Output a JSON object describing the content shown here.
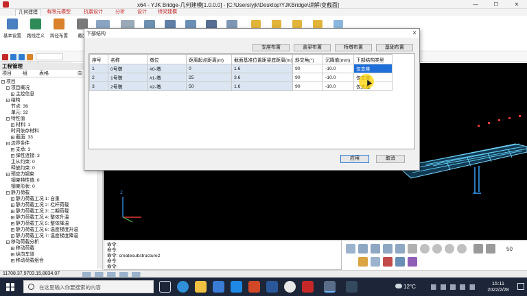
{
  "window": {
    "title": "x64 - YJK Bridge-几何建模[1.0.0.0] - [C:\\Users\\yjk\\Desktop\\YJKBridge\\讲解\\变截面]"
  },
  "ribbon": {
    "tabs": [
      "几何建模",
      "有限元模型",
      "抗震设计",
      "分析",
      "设计",
      "桥梁建模"
    ],
    "buttons": [
      "基本设置",
      "路线定义",
      "跨径布置",
      "截面"
    ],
    "group_label": "基本信息"
  },
  "panel": {
    "header": "工程管理",
    "tabs": [
      "项目",
      "组",
      "表格",
      "向"
    ],
    "tree": [
      {
        "level": 0,
        "box": "−",
        "text": "项目"
      },
      {
        "level": 1,
        "box": "−",
        "text": "项目概况"
      },
      {
        "level": 2,
        "box": "+",
        "text": "主控信息"
      },
      {
        "level": 1,
        "box": "−",
        "text": "结构"
      },
      {
        "level": 2,
        "box": "",
        "text": "节点: 36"
      },
      {
        "level": 2,
        "box": "",
        "text": "单元: 32"
      },
      {
        "level": 1,
        "box": "−",
        "text": "特性值"
      },
      {
        "level": 2,
        "box": "+",
        "text": "材料: 1"
      },
      {
        "level": 2,
        "box": "",
        "text": "时间依存材料"
      },
      {
        "level": 2,
        "box": "+",
        "text": "截面: 33"
      },
      {
        "level": 1,
        "box": "−",
        "text": "边界条件"
      },
      {
        "level": 2,
        "box": "+",
        "text": "支承: 3"
      },
      {
        "level": 2,
        "box": "+",
        "text": "弹性连接: 3"
      },
      {
        "level": 2,
        "box": "",
        "text": "主从约束: 0"
      },
      {
        "level": 2,
        "box": "",
        "text": "释放约束: 0"
      },
      {
        "level": 1,
        "box": "−",
        "text": "预应力钢束"
      },
      {
        "level": 2,
        "box": "",
        "text": "钢束特性值: 0"
      },
      {
        "level": 2,
        "box": "",
        "text": "钢束形状: 0"
      },
      {
        "level": 1,
        "box": "−",
        "text": "静力荷载"
      },
      {
        "level": 2,
        "box": "+",
        "text": "静力荷载工况 1: 自重"
      },
      {
        "level": 2,
        "box": "+",
        "text": "静力荷载工况 2: 栏杆荷载"
      },
      {
        "level": 2,
        "box": "+",
        "text": "静力荷载工况 3: 二期荷载"
      },
      {
        "level": 2,
        "box": "+",
        "text": "静力荷载工况 4: 整体升温"
      },
      {
        "level": 2,
        "box": "+",
        "text": "静力荷载工况 5: 整体降温"
      },
      {
        "level": 2,
        "box": "+",
        "text": "静力荷载工况 6: 温度梯度升温"
      },
      {
        "level": 2,
        "box": "+",
        "text": "静力荷载工况 7: 温度梯度降温"
      },
      {
        "level": 1,
        "box": "−",
        "text": "移动荷载分析"
      },
      {
        "level": 2,
        "box": "+",
        "text": "移动荷载"
      },
      {
        "level": 2,
        "box": "+",
        "text": "纵向车道"
      },
      {
        "level": 2,
        "box": "+",
        "text": "移动荷载组合"
      }
    ]
  },
  "dialog": {
    "title": "下部结构",
    "top_buttons": [
      "支座布置",
      "盖梁布置",
      "桥墩布置",
      "基础布置"
    ],
    "columns": [
      "序号",
      "名称",
      "墩位",
      "距离起点距离(m)",
      "截面基准位置距梁底距离(m)",
      "斜交角(°)",
      "沉降值(mm)",
      "下部结构类型"
    ],
    "rows": [
      [
        "1",
        "0号墩",
        "#0-墩",
        "0",
        "1.6",
        "90",
        "-10.0",
        "仅支座"
      ],
      [
        "2",
        "1号墩",
        "#1-墩",
        "25",
        "3.6",
        "90",
        "-10.0",
        "仅支座"
      ],
      [
        "3",
        "2号墩",
        "#2-墩",
        "50",
        "1.6",
        "90",
        "-10.0",
        "仅支座"
      ]
    ],
    "apply_label": "应用",
    "cancel_label": "取消"
  },
  "command": {
    "lines": [
      "命令:",
      "命令:",
      "命令: createsubstructure2",
      "命令:",
      "命令:"
    ]
  },
  "status": {
    "coords": "11708.37,9703.15,8834.07"
  },
  "taskbar": {
    "search_placeholder": "在这里输入你要搜索的内容",
    "weather": "12°C",
    "time": "15:11",
    "date": "2022/2/28",
    "zoom_label": "50"
  },
  "colors": {
    "accent": "#1e6fd9",
    "viewport": "#000000",
    "model": "#5fc8f0"
  }
}
